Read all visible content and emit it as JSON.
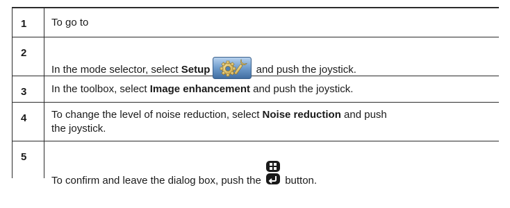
{
  "steps": [
    {
      "number": "1",
      "text": "To go to"
    },
    {
      "number": "2",
      "text_before": "In the mode selector, select ",
      "bold": "Setup",
      "text_after": " and push the joystick.",
      "icon": "setup-gear-icon"
    },
    {
      "number": "3",
      "text_before": "In the toolbox, select ",
      "bold": "Image enhancement",
      "text_after": " and push the joystick."
    },
    {
      "number": "4",
      "text_before": "To change the level of noise reduction, select ",
      "bold": "Noise reduction",
      "text_after": " and push",
      "line2": "the joystick."
    },
    {
      "number": "5",
      "text_before": "To confirm and leave the dialog box, push the ",
      "text_after": " button.",
      "icon": "menu-back-button-icon"
    }
  ],
  "colors": {
    "border": "#2b2b2b",
    "setup_icon_bg": "#5a87b8",
    "button_icon": "#1a1a1a"
  }
}
